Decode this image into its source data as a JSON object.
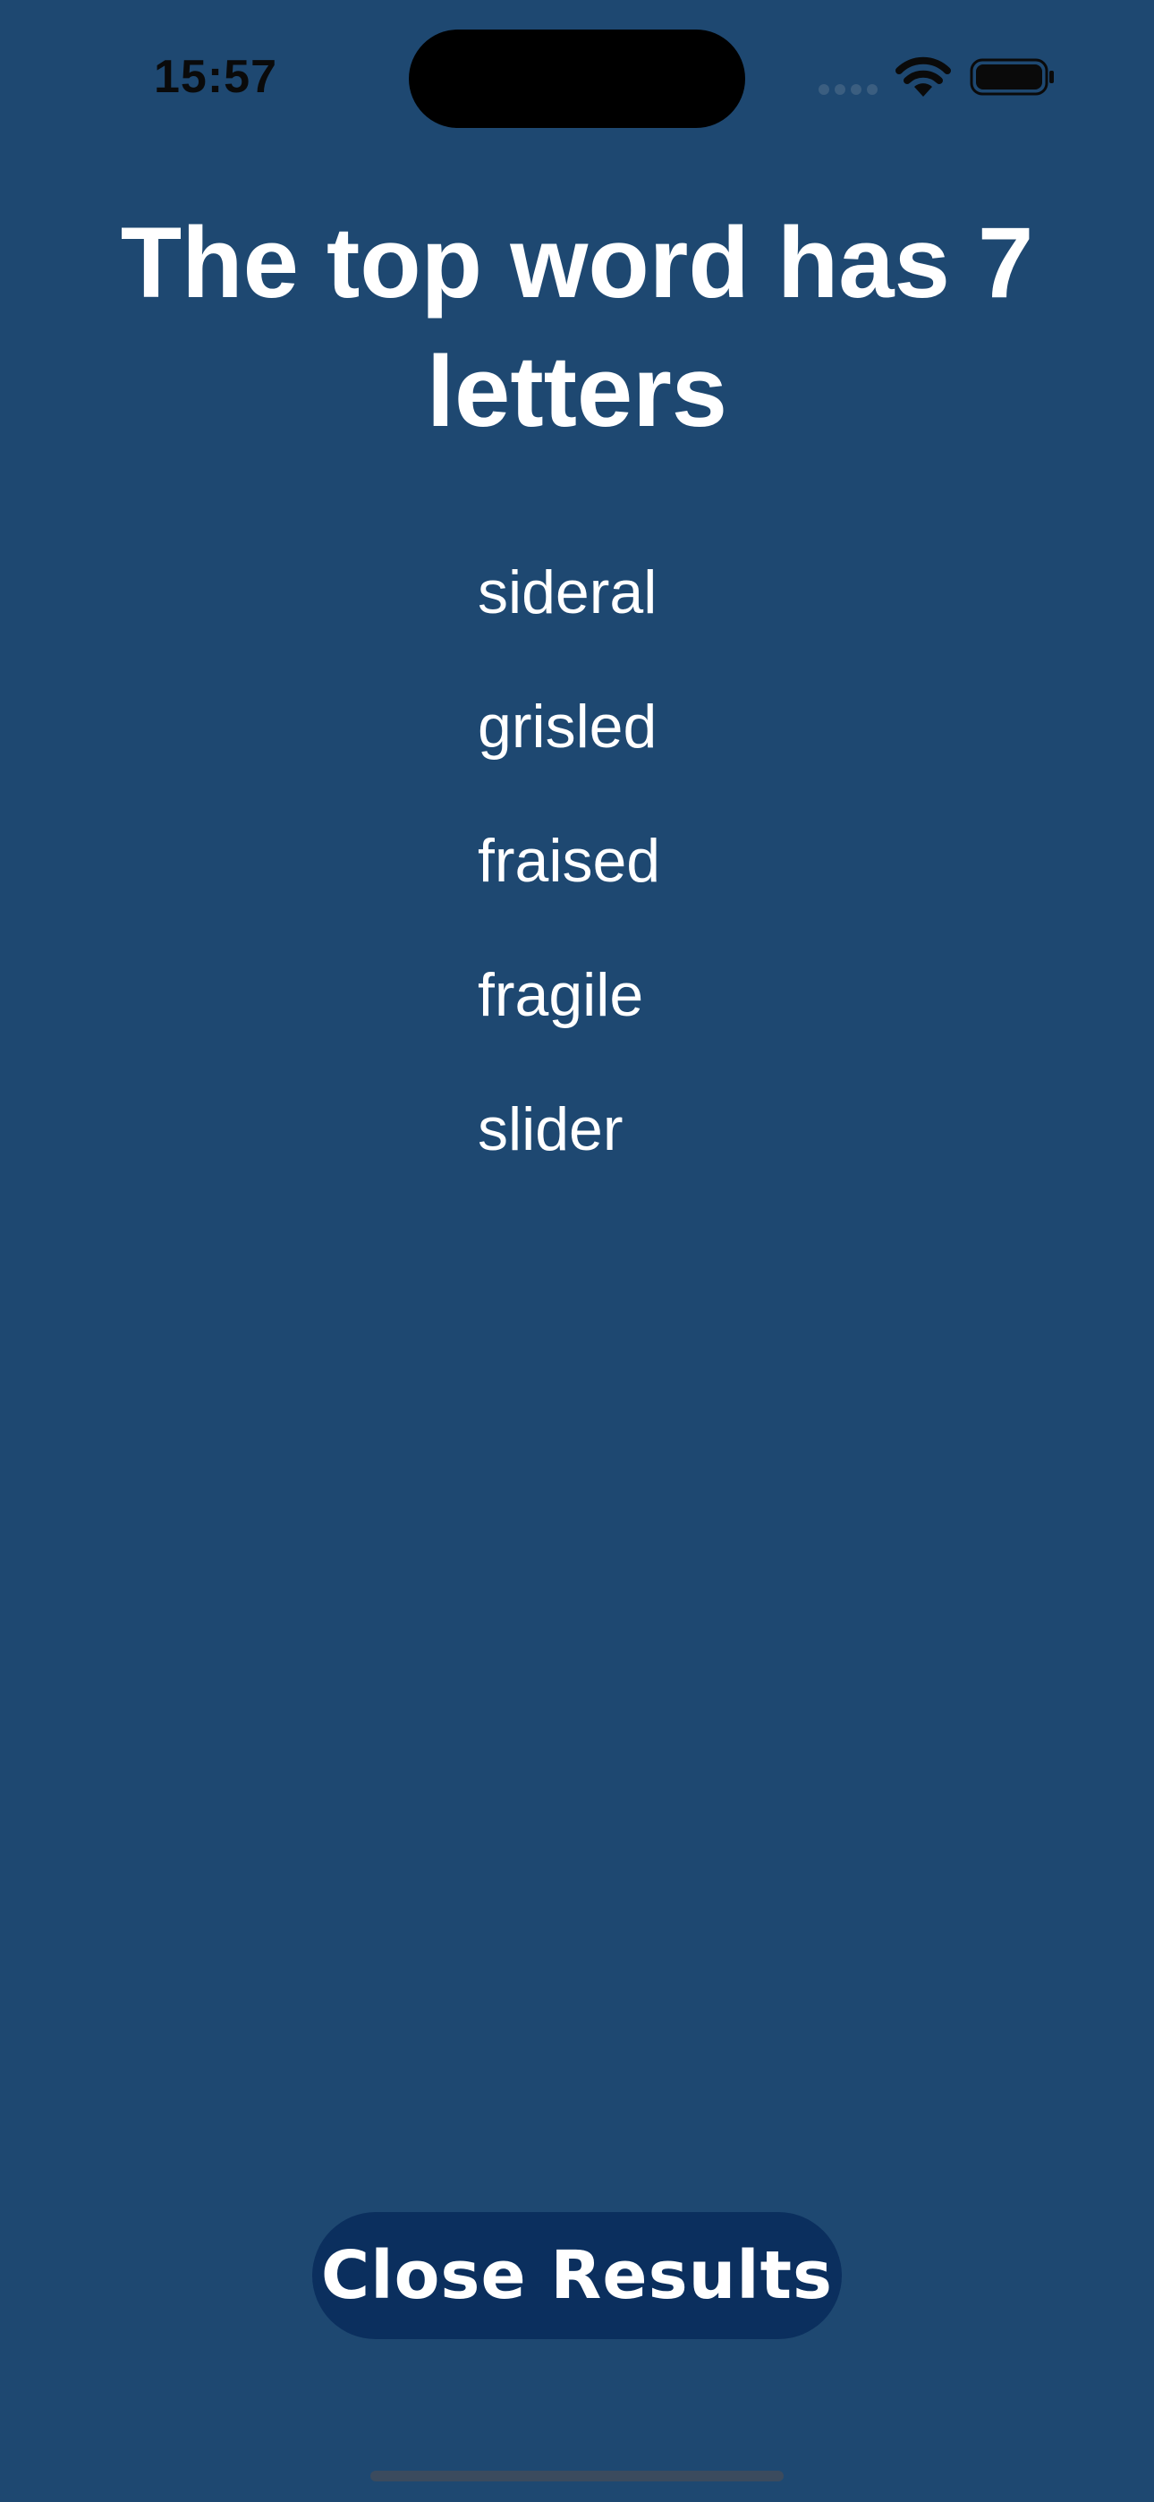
{
  "status_bar": {
    "time": "15:57",
    "icons": [
      "signal-icon",
      "wifi-icon",
      "battery-icon"
    ]
  },
  "title": "The top word has 7 letters",
  "words": [
    "sideral",
    "grisled",
    "fraised",
    "fragile",
    "slider"
  ],
  "close_button": {
    "label": "Close Results"
  },
  "colors": {
    "background": "#1e4871",
    "button": "#0b2f5e",
    "text": "#ffffff"
  }
}
